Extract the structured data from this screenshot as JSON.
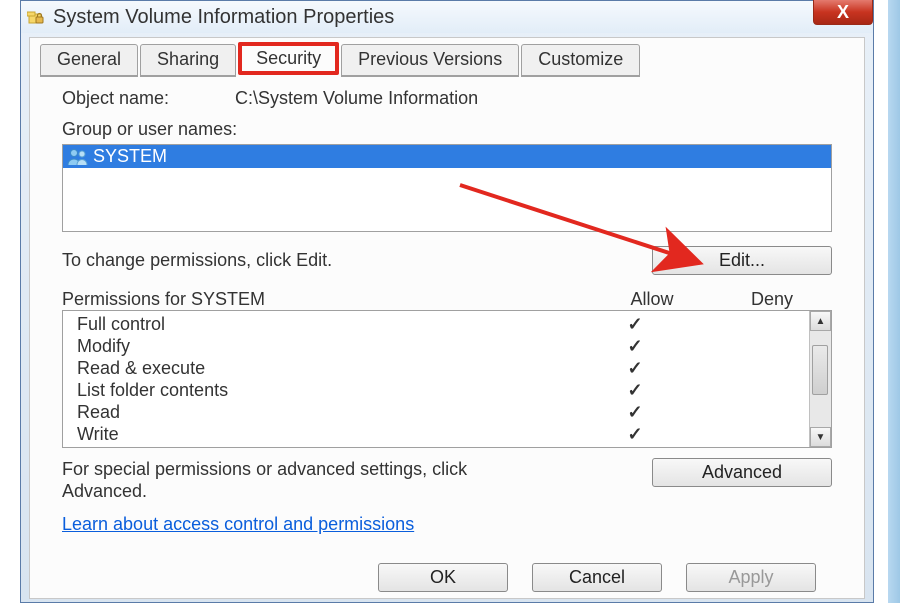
{
  "window": {
    "title": "System Volume Information Properties",
    "close": "X"
  },
  "tabs": {
    "general": "General",
    "sharing": "Sharing",
    "security": "Security",
    "previous": "Previous Versions",
    "customize": "Customize"
  },
  "security": {
    "object_label": "Object name:",
    "object_value": "C:\\System Volume Information",
    "group_label": "Group or user names:",
    "users": {
      "system": "SYSTEM"
    },
    "edit_hint": "To change permissions, click Edit.",
    "edit_button": "Edit...",
    "perm_header": "Permissions for SYSTEM",
    "allow": "Allow",
    "deny": "Deny",
    "perms": {
      "full": "Full control",
      "modify": "Modify",
      "readex": "Read & execute",
      "listfolder": "List folder contents",
      "read": "Read",
      "write": "Write"
    },
    "adv_hint": "For special permissions or advanced settings, click Advanced.",
    "adv_button": "Advanced",
    "learn_link": "Learn about access control and permissions"
  },
  "buttons": {
    "ok": "OK",
    "cancel": "Cancel",
    "apply": "Apply"
  }
}
